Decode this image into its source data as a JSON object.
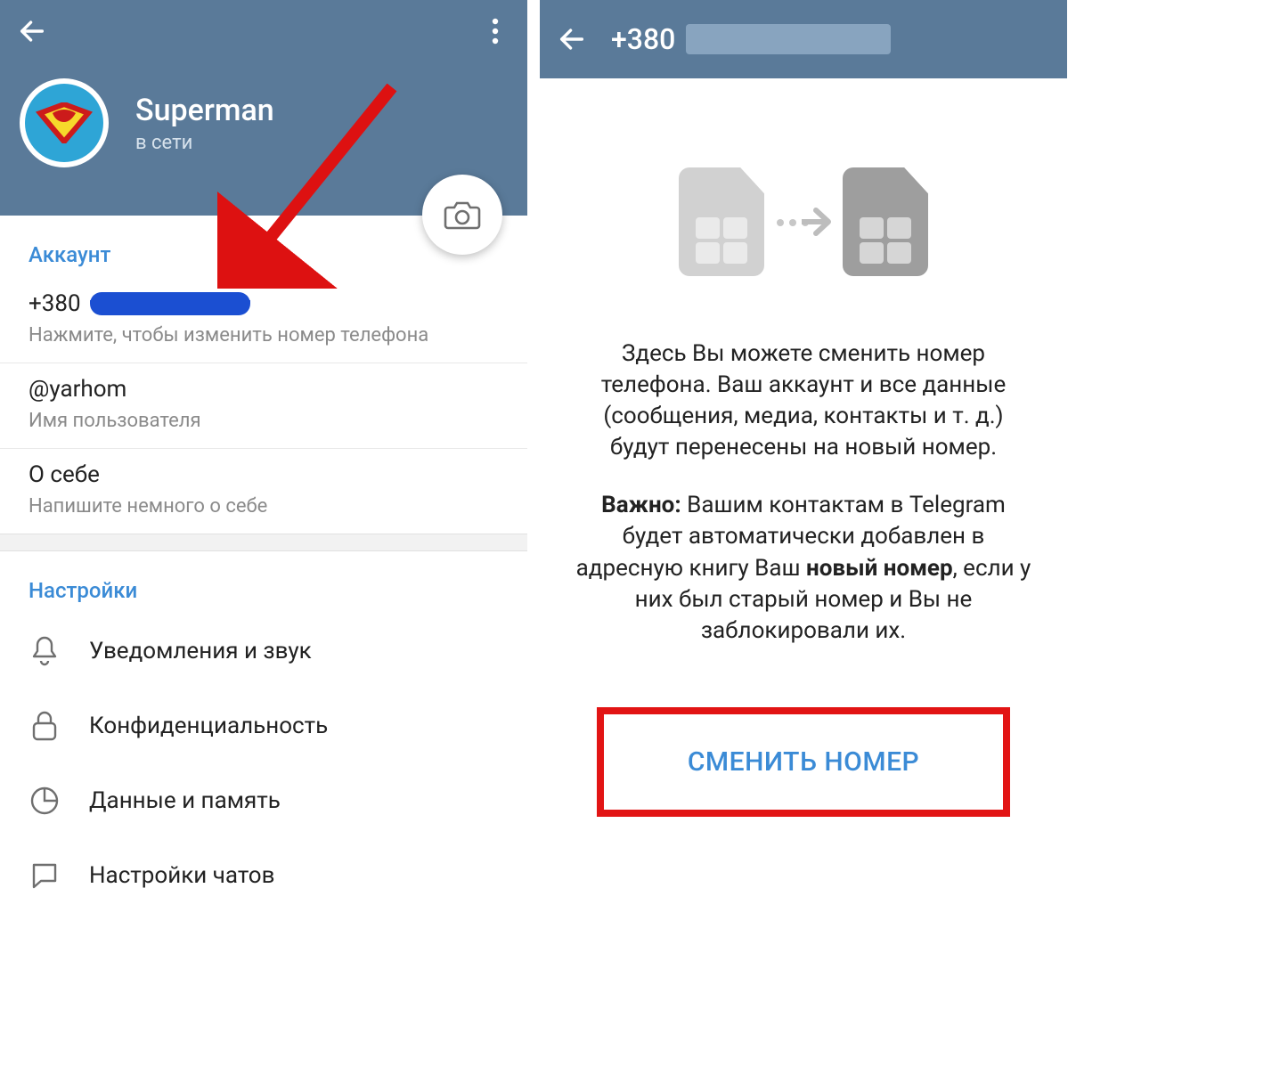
{
  "left": {
    "profile": {
      "name": "Superman",
      "status": "в сети"
    },
    "account": {
      "section_title": "Аккаунт",
      "phone_prefix": "+380",
      "phone_hint": "Нажмите, чтобы изменить номер телефона",
      "username": "@yarhom",
      "username_hint": "Имя пользователя",
      "bio_title": "О себе",
      "bio_hint": "Напишите немного о себе"
    },
    "settings": {
      "section_title": "Настройки",
      "items": [
        {
          "label": "Уведомления и звук",
          "icon": "bell-icon"
        },
        {
          "label": "Конфиденциальность",
          "icon": "lock-icon"
        },
        {
          "label": "Данные и память",
          "icon": "pie-icon"
        },
        {
          "label": "Настройки чатов",
          "icon": "chat-icon"
        }
      ]
    }
  },
  "right": {
    "phone_prefix": "+380",
    "paragraph1": "Здесь Вы можете сменить номер телефона. Ваш аккаунт и все данные (сообщения, медиа, контакты и т. д.) будут перенесены на новый номер.",
    "important_label": "Важно:",
    "paragraph2a": " Вашим контактам в Telegram будет автоматически добавлен в адресную книгу Ваш ",
    "new_number_bold": "новый номер",
    "paragraph2b": ", если у них был старый номер и Вы не заблокировали их.",
    "button_label": "СМЕНИТЬ НОМЕР"
  }
}
